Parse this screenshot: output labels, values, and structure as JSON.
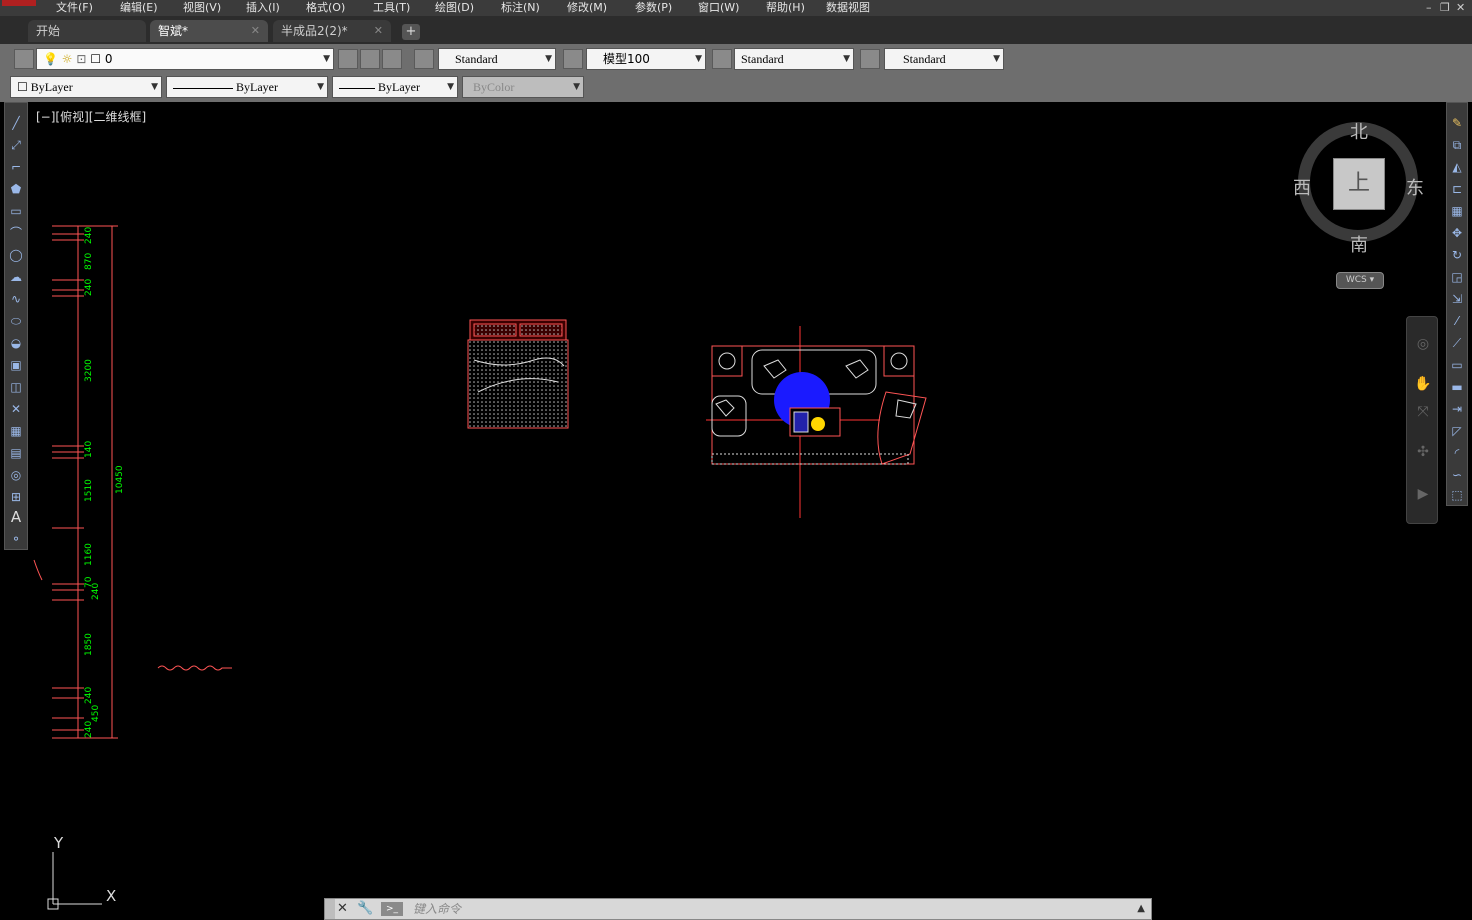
{
  "menu": {
    "items": [
      "文件(F)",
      "编辑(E)",
      "视图(V)",
      "插入(I)",
      "格式(O)",
      "工具(T)",
      "绘图(D)",
      "标注(N)",
      "修改(M)",
      "参数(P)",
      "窗口(W)",
      "帮助(H)",
      "数据视图"
    ]
  },
  "tabs": [
    {
      "label": "开始",
      "active": false
    },
    {
      "label": "智斌*",
      "active": true
    },
    {
      "label": "半成品2(2)*",
      "active": false
    }
  ],
  "layer": {
    "current": "0"
  },
  "styles": {
    "text_style": "Standard",
    "dim_style": "模型100",
    "table_style": "Standard",
    "mleader_style": "Standard"
  },
  "properties": {
    "color": "ByLayer",
    "linetype": "ByLayer",
    "lineweight": "ByLayer",
    "plotstyle": "ByColor"
  },
  "viewport": {
    "label": "[−][俯视][二维线框]"
  },
  "viewcube": {
    "north": "北",
    "south": "南",
    "east": "东",
    "west": "西",
    "face": "上",
    "ucs": "WCS"
  },
  "dimensions": {
    "segments": [
      "240",
      "870",
      "240",
      "3200",
      "140",
      "1510",
      "1160",
      "70",
      "240",
      "1850",
      "240",
      "450",
      "240"
    ],
    "total": "10450"
  },
  "ucs_icon": {
    "x_label": "X",
    "y_label": "Y"
  },
  "command_line": {
    "placeholder": "键入命令"
  },
  "colors": {
    "accent_red": "#ff5555",
    "dim_green": "#00ff00",
    "blue_fill": "#1a1aff",
    "yellow": "#ffd700"
  }
}
